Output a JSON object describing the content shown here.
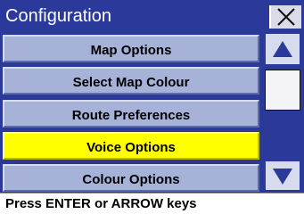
{
  "window": {
    "title": "Configuration",
    "close_icon": "close-icon"
  },
  "menu": {
    "items": [
      {
        "label": "Map Options",
        "selected": false
      },
      {
        "label": "Select Map Colour",
        "selected": false
      },
      {
        "label": "Route Preferences",
        "selected": false
      },
      {
        "label": "Voice Options",
        "selected": true
      },
      {
        "label": "Colour Options",
        "selected": false
      }
    ]
  },
  "scrollbar": {
    "up_icon": "arrow-up-icon",
    "down_icon": "arrow-down-icon"
  },
  "status": {
    "text": "Press ENTER or ARROW keys"
  },
  "colors": {
    "accent": "#2b3a9a",
    "item_bg": "#a7b2d8",
    "selected_bg": "#ffff00",
    "title_text": "#ffffff"
  }
}
